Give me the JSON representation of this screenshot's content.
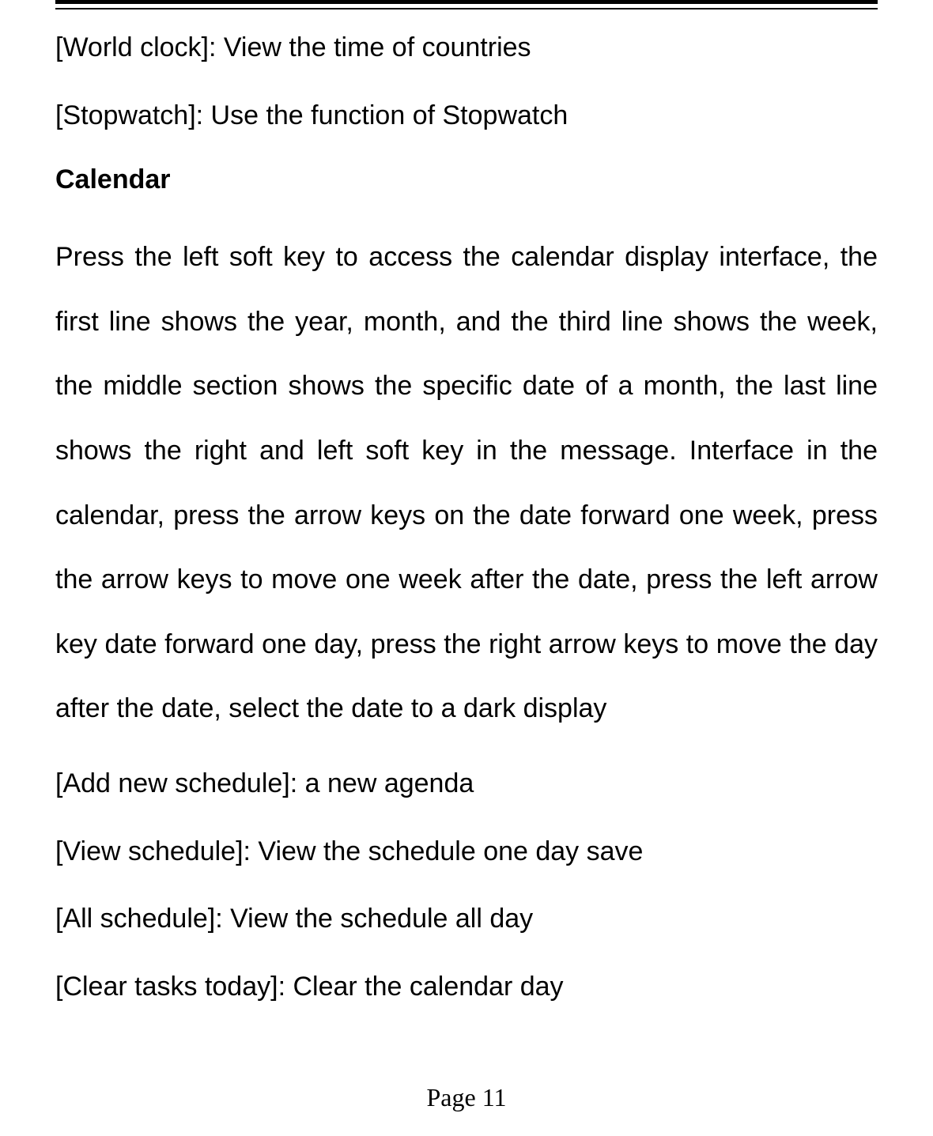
{
  "lines": {
    "world_clock": "[World clock]: View the time of countries",
    "stopwatch": "[Stopwatch]: Use the function of Stopwatch"
  },
  "heading": "Calendar",
  "paragraph": "Press the left soft key to access the calendar display interface, the first line shows the year, month, and the third line shows the week, the middle section shows the specific date of a month, the last line shows the right and left soft key in the message. Interface in the calendar, press the arrow keys on the date forward one week, press the arrow keys to move one week after the date, press the left arrow key date forward one day, press the right arrow keys to move the day after the date, select the date to a dark display",
  "items": {
    "add_new_schedule": "[Add new schedule]: a new agenda",
    "view_schedule": "[View schedule]: View the schedule one day save",
    "all_schedule": "[All schedule]: View the schedule all day",
    "clear_tasks_today": "[Clear tasks today]: Clear the calendar day"
  },
  "footer": "Page 11"
}
